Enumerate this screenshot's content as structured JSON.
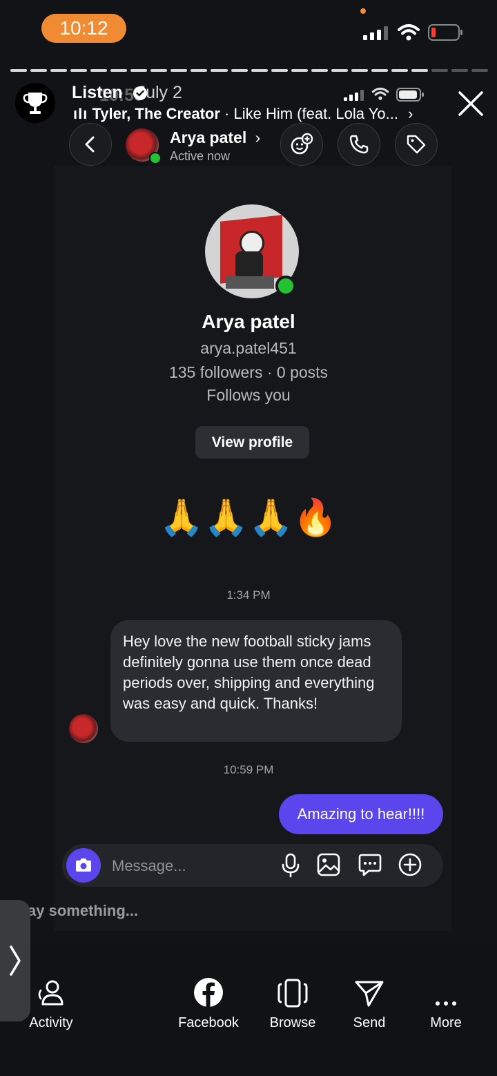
{
  "status_bar": {
    "time": "10:12"
  },
  "story_header": {
    "title": "Listen",
    "overlay_time": "10:59",
    "date": "July 2",
    "artist": "Tyler, The Creator",
    "track": "· Like Him (feat. Lola Yo..."
  },
  "chat_header": {
    "name": "Arya patel",
    "status": "Active now"
  },
  "profile": {
    "name": "Arya patel",
    "username": "arya.patel451",
    "stats": "135 followers · 0 posts",
    "follows": "Follows you",
    "view_profile_label": "View profile"
  },
  "messages": {
    "emoji_message": "🙏🙏🙏🔥",
    "timestamp_1": "1:34 PM",
    "incoming_text": "Hey love the new football sticky jams definitely gonna use them once dead periods over, shipping and everything was easy and quick. Thanks!",
    "timestamp_2": "10:59 PM",
    "outgoing_text": "Amazing to hear!!!!"
  },
  "composer": {
    "placeholder": "Message...",
    "story_reply_placeholder": "ay something..."
  },
  "bottom_nav": {
    "items": [
      {
        "label": "Activity",
        "icon": "activity-icon"
      },
      {
        "label": "Facebook",
        "icon": "facebook-icon"
      },
      {
        "label": "Browse",
        "icon": "browse-icon"
      },
      {
        "label": "Send",
        "icon": "send-icon"
      },
      {
        "label": "More",
        "icon": "more-icon"
      }
    ]
  },
  "colors": {
    "accent_purple": "#5b46ee",
    "time_pill": "#f08b33",
    "online_green": "#22c232",
    "background": "#121316"
  },
  "story_progress": {
    "segments": 24,
    "completed": 21
  }
}
